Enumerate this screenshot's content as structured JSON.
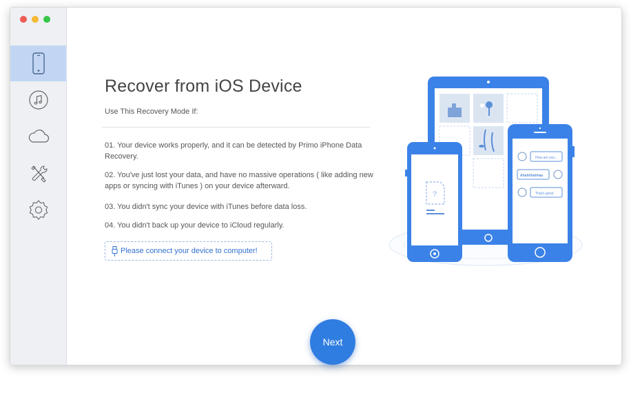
{
  "window": {
    "traffic_lights": [
      "#ef5d55",
      "#f5b935",
      "#35c648"
    ]
  },
  "sidebar": {
    "items": [
      {
        "id": "ios-device",
        "icon": "iphone-icon",
        "active": true
      },
      {
        "id": "itunes",
        "icon": "music-note-icon",
        "active": false
      },
      {
        "id": "icloud",
        "icon": "cloud-icon",
        "active": false
      },
      {
        "id": "tools",
        "icon": "tools-icon",
        "active": false
      },
      {
        "id": "settings",
        "icon": "gear-icon",
        "active": false
      }
    ]
  },
  "main": {
    "title": "Recover from iOS Device",
    "subtitle": "Use This Recovery Mode If:",
    "steps": [
      "01. Your device works properly, and it can be detected by Primo iPhone Data Recovery.",
      "02. You've just lost your data, and have no massive operations ( like adding new apps or syncing with iTunes ) on your device afterward.",
      "03. You didn't sync your device with iTunes before data loss.",
      "04. You didn't back up your device to iCloud regularly."
    ],
    "connect_hint": "Please connect your device to computer!",
    "next_label": "Next"
  },
  "illustration": {
    "chat_bubbles": [
      "How are you...",
      "Ahahhhahhaa",
      "That's good."
    ]
  },
  "colors": {
    "accent": "#2f7de1",
    "sidebar_bg": "#eef0f4",
    "active_item_bg": "#c2d6f4",
    "device_blue": "#3b82e8"
  }
}
